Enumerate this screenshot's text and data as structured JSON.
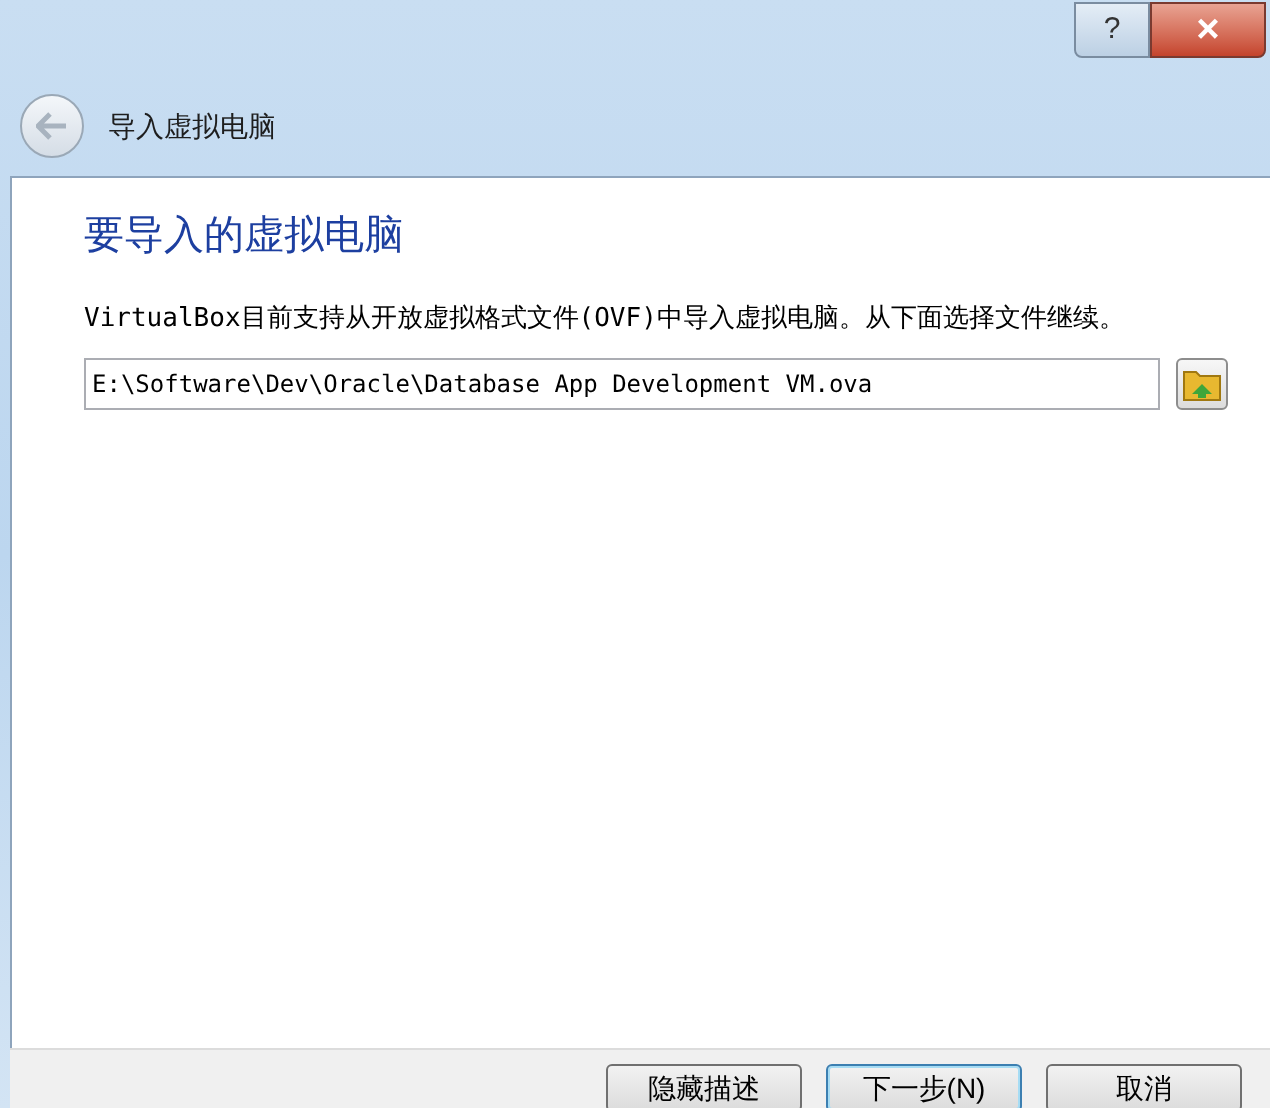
{
  "window": {
    "help_label": "?",
    "close_label": "×"
  },
  "header": {
    "title": "导入虚拟电脑"
  },
  "page": {
    "heading": "要导入的虚拟电脑",
    "description": "VirtualBox目前支持从开放虚拟格式文件(OVF)中导入虚拟电脑。从下面选择文件继续。",
    "file_field": {
      "value": "E:\\Software\\Dev\\Oracle\\Database App Development VM.ova"
    }
  },
  "buttons": [
    {
      "label": "隐藏描述",
      "default": false
    },
    {
      "label": "下一步(N)",
      "default": true
    },
    {
      "label": "取消",
      "default": false
    }
  ]
}
